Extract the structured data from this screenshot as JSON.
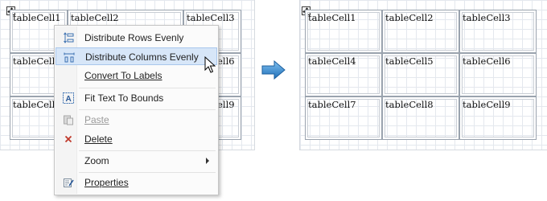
{
  "left_table": {
    "cells": [
      "tableCell1",
      "tableCell2",
      "tableCell3",
      "tableCell4",
      "",
      "tableCell6",
      "tableCell7",
      "",
      "tableCell9"
    ]
  },
  "right_table": {
    "cells": [
      "tableCell1",
      "tableCell2",
      "tableCell3",
      "tableCell4",
      "tableCell5",
      "tableCell6",
      "tableCell7",
      "tableCell8",
      "tableCell9"
    ]
  },
  "context_menu": {
    "items": [
      {
        "label": "Distribute Rows Evenly",
        "icon": "distribute-rows-icon",
        "enabled": true,
        "highlighted": false
      },
      {
        "label": "Distribute Columns Evenly",
        "icon": "distribute-columns-icon",
        "enabled": true,
        "highlighted": true
      },
      {
        "label": "Convert To Labels",
        "icon": "",
        "enabled": true,
        "highlighted": false
      },
      {
        "label": "Fit Text To Bounds",
        "icon": "fit-text-icon",
        "enabled": true,
        "highlighted": false
      },
      {
        "label": "Paste",
        "icon": "paste-icon",
        "enabled": false,
        "highlighted": false
      },
      {
        "label": "Delete",
        "icon": "delete-icon",
        "enabled": true,
        "highlighted": false
      },
      {
        "label": "Zoom",
        "icon": "",
        "enabled": true,
        "highlighted": false,
        "submenu": true
      },
      {
        "label": "Properties",
        "icon": "properties-icon",
        "enabled": true,
        "highlighted": false
      }
    ]
  },
  "colors": {
    "highlight_bg": "#d7e6f8",
    "arrow": "#2e86d1",
    "delete_icon": "#c0392b"
  }
}
